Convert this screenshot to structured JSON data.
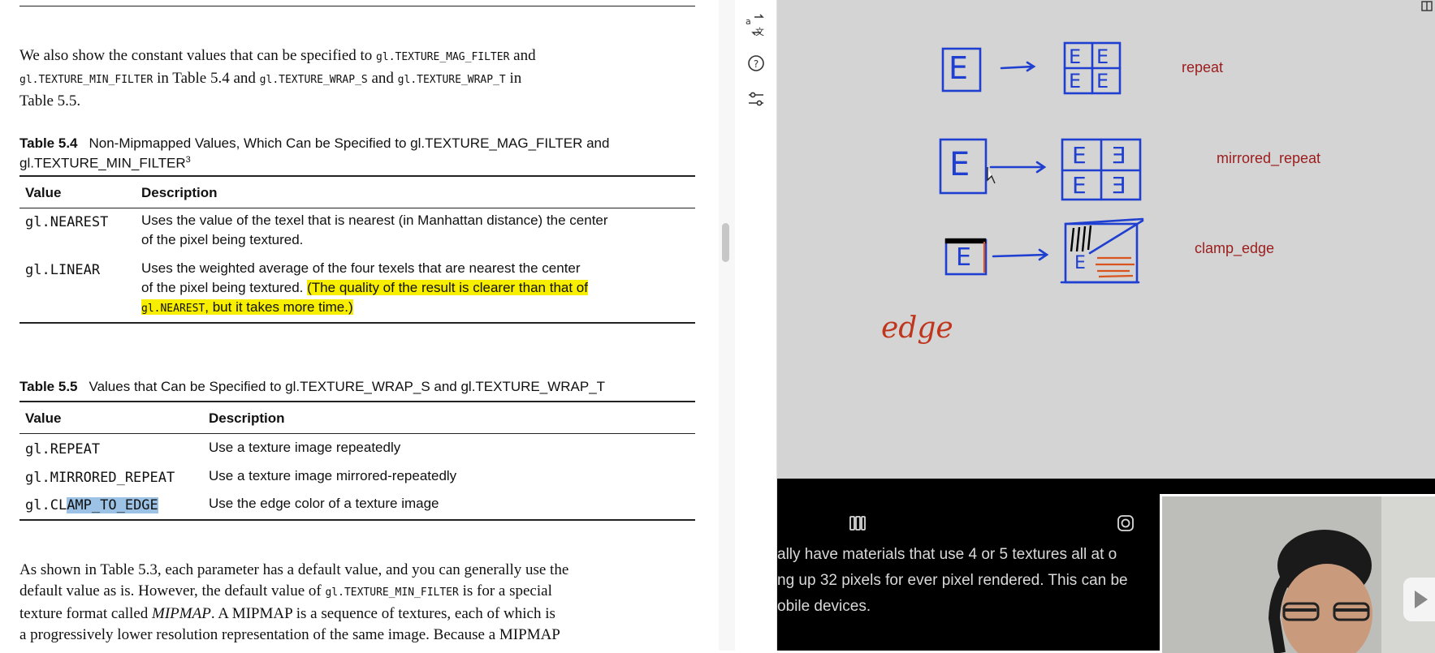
{
  "document": {
    "intro_parts": [
      "We also show the constant values that can be specified to ",
      "gl.TEXTURE_MAG_FILTER",
      " and",
      "gl.TEXTURE_MIN_FILTER",
      " in Table 5.4 and ",
      "gl.TEXTURE_WRAP_S",
      " and ",
      "gl.TEXTURE_WRAP_T",
      " in",
      "Table 5.5."
    ],
    "table54": {
      "number": "Table 5.4",
      "caption_line1": "Non-Mipmapped Values, Which Can be Specified to gl.TEXTURE_MAG_FILTER and",
      "caption_line2": "gl.TEXTURE_MIN_FILTER",
      "caption_sup": "3",
      "col_value": "Value",
      "col_desc": "Description",
      "rows": [
        {
          "value": "gl.NEAREST",
          "desc_line1": "Uses the value of the texel that is nearest (in Manhattan distance) the center",
          "desc_line2": "of the pixel being textured."
        },
        {
          "value": "gl.LINEAR",
          "desc_line1": "Uses the weighted average of the four texels that are nearest the center",
          "desc_line2a": "of the pixel being textured. ",
          "desc_line2b": "(The quality of the result is clearer than that of",
          "desc_line3_code": "gl.NEAREST",
          "desc_line3_text": ", but it takes more time.)"
        }
      ]
    },
    "table55": {
      "number": "Table 5.5",
      "caption": "Values that Can be Specified to gl.TEXTURE_WRAP_S and gl.TEXTURE_WRAP_T",
      "col_value": "Value",
      "col_desc": "Description",
      "rows": [
        {
          "value": "gl.REPEAT",
          "desc": "Use a texture image repeatedly"
        },
        {
          "value": "gl.MIRRORED_REPEAT",
          "desc": "Use a texture image mirrored-repeatedly"
        },
        {
          "value_plain": "gl.CL",
          "value_selected": "AMP_TO_EDGE",
          "desc": "Use the edge color of a texture image"
        }
      ]
    },
    "outro_line1": "As shown in Table 5.3, each parameter has a default value, and you can generally use the",
    "outro_line2a": "default value as is. However, the default value of ",
    "outro_line2_code": "gl.TEXTURE_MIN_FILTER",
    "outro_line2b": " is for a special",
    "outro_line3a": "texture format called ",
    "outro_line3_em": "MIPMAP",
    "outro_line3b": ". A MIPMAP is a sequence of textures, each of which is",
    "outro_line4": "a progressively lower resolution representation of the same image. Because a MIPMAP"
  },
  "tools": {
    "icons": [
      "translate-icon",
      "help-icon",
      "sliders-icon"
    ]
  },
  "whiteboard": {
    "labels": {
      "repeat": "repeat",
      "mirrored": "mirrored_repeat",
      "clamp": "clamp_edge",
      "edge": "edge"
    },
    "glyph": "E",
    "glyph_mirror": "Ǝ"
  },
  "video": {
    "subtitle_line1": "ally have materials that use 4 or 5 textures all at o",
    "subtitle_line2": "ng up 32 pixels for ever pixel rendered. This can be",
    "subtitle_line3": "obile devices."
  },
  "colors": {
    "highlight": "#f8ee00",
    "selection": "#9cc3e6",
    "ink_blue": "#1f3fd1",
    "ink_red": "#9b1c1c"
  }
}
